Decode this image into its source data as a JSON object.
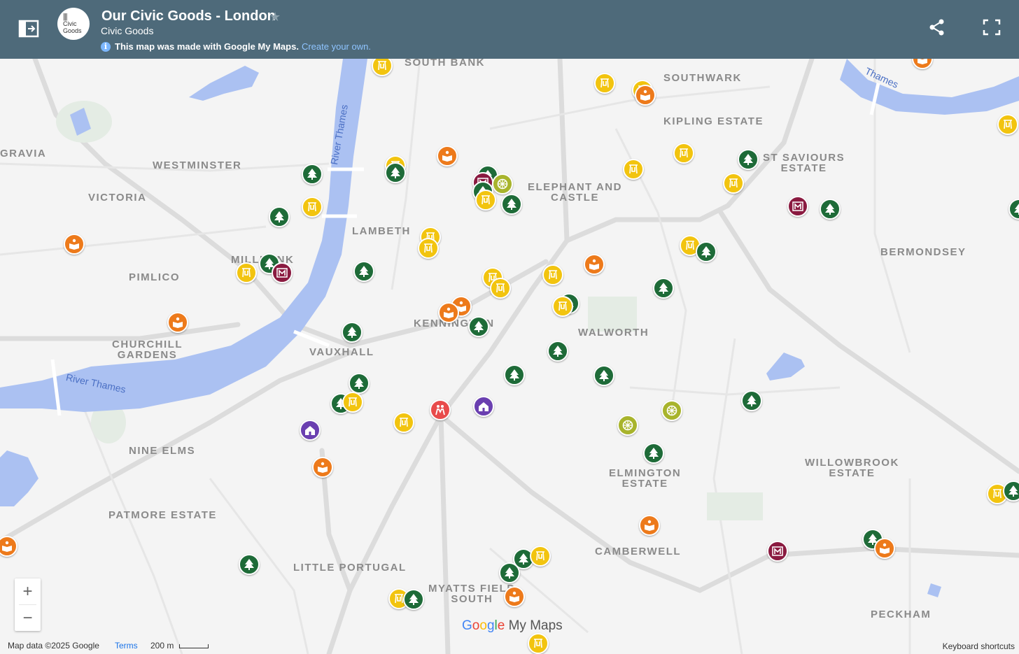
{
  "header": {
    "title": "Our Civic Goods - London",
    "subtitle": "Civic Goods",
    "logo_text_1": "Civic",
    "logo_text_2": "Goods",
    "notice": "This map was made with Google My Maps.",
    "notice_link": "Create your own.",
    "color": "#4e6a7a"
  },
  "map": {
    "labels": [
      "SOUTH BANK",
      "SOUTHWARK",
      "KIPLING ESTATE",
      "GRAVIA",
      "WESTMINSTER",
      "VICTORIA",
      "ST SAVIOURS ESTATE",
      "ELEPHANT AND CASTLE",
      "LAMBETH",
      "BERMONDSEY",
      "MILLBANK",
      "PIMLICO",
      "KENNINGTON",
      "WALWORTH",
      "CHURCHILL GARDENS",
      "VAUXHALL",
      "NINE ELMS",
      "WILLOWBROOK ESTATE",
      "ELMINGTON ESTATE",
      "PATMORE ESTATE",
      "CAMBERWELL",
      "LITTLE PORTUGAL",
      "MYATTS FIELD SOUTH",
      "PECKHAM"
    ],
    "river_labels": [
      "River Thames",
      "River Thames",
      "Thames"
    ],
    "marker_colors": {
      "tree": "#1e6b38",
      "playground": "#f2c40f",
      "library": "#ed7a1b",
      "museum": "#8a1a40",
      "sports": "#a8b42c",
      "school": "#6a3fb0",
      "community": "#e84b4b"
    }
  },
  "controls": {
    "zoom_in": "+",
    "zoom_out": "−",
    "brand_google": "Google",
    "brand_mymaps": "My Maps",
    "map_data": "Map data ©2025 Google",
    "terms": "Terms",
    "scale": "200 m",
    "shortcuts": "Keyboard shortcuts"
  }
}
